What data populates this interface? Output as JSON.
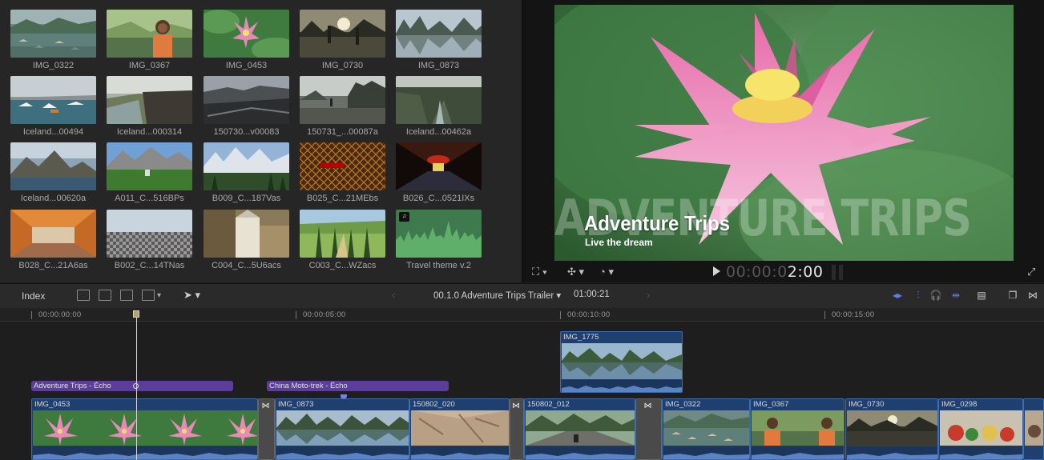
{
  "browser": {
    "clips": [
      {
        "name": "IMG_0322"
      },
      {
        "name": "IMG_0367"
      },
      {
        "name": "IMG_0453"
      },
      {
        "name": "IMG_0730"
      },
      {
        "name": "IMG_0873"
      },
      {
        "name": "Iceland...00494"
      },
      {
        "name": "Iceland...000314"
      },
      {
        "name": "150730...v00083"
      },
      {
        "name": "150731_...00087a"
      },
      {
        "name": "Iceland...00462a"
      },
      {
        "name": "Iceland...00620a"
      },
      {
        "name": "A011_C...516BPs"
      },
      {
        "name": "B009_C...187Vas"
      },
      {
        "name": "B025_C...21MEbs"
      },
      {
        "name": "B026_C...0521IXs"
      },
      {
        "name": "B028_C...21A6as"
      },
      {
        "name": "B002_C...14TNas"
      },
      {
        "name": "C004_C...5U6acs"
      },
      {
        "name": "C003_C...WZacs"
      },
      {
        "name": "Travel theme v.2"
      }
    ]
  },
  "viewer": {
    "background_title": "ADVENTURE TRIPS",
    "title": "Adventure Trips",
    "subtitle": "Live the dream",
    "timecode_dim": "00:00:0",
    "timecode_lit": "2:00"
  },
  "toolbar": {
    "index_label": "Index",
    "project_name": "00.1.0 Adventure Trips Trailer",
    "project_duration": "01:00:21"
  },
  "timeline": {
    "ruler": [
      "00:00:00:00",
      "00:00:05:00",
      "00:00:10:00",
      "00:00:15:00"
    ],
    "connected_clip": "IMG_1775",
    "audio_clips": [
      "Adventure Trips - Écho",
      "China Moto-trek - Écho"
    ],
    "primary_clips": [
      "IMG_0453",
      "IMG_0873",
      "150802_020",
      "150802_012",
      "IMG_0322",
      "IMG_0367",
      "IMG_0730",
      "IMG_0298",
      ""
    ]
  },
  "colors": {
    "clip_blue": "#1f3f6e",
    "audio_purple": "#5b3e99",
    "accent_blue": "#5b7cf0"
  }
}
